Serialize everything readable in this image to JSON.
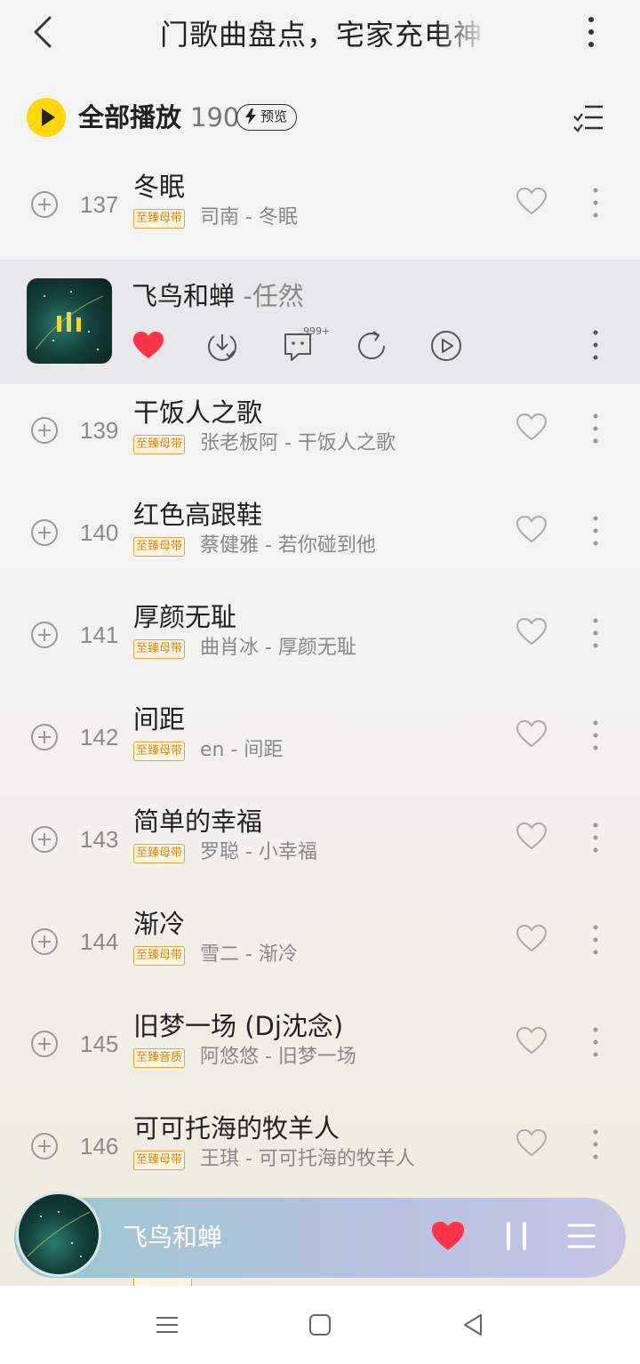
{
  "header": {
    "title": "门歌曲盘点，宅家充电神",
    "back_icon": "chevron-left-icon",
    "more_icon": "more-vertical-icon"
  },
  "playall": {
    "label": "全部播放",
    "count": "190",
    "preview_label": "预览",
    "accent": "#ffd60a"
  },
  "current_song": {
    "title": "飞鸟和蝉",
    "artist": " -任然",
    "comment_count": "999+",
    "liked": true
  },
  "songs": [
    {
      "num": "137",
      "title": "冬眠",
      "tag": "至臻母带",
      "artist": "司南 - 冬眠"
    },
    {
      "num": "139",
      "title": "干饭人之歌",
      "tag": "至臻母带",
      "artist": "张老板阿 - 干饭人之歌"
    },
    {
      "num": "140",
      "title": "红色高跟鞋",
      "tag": "至臻母带",
      "artist": "蔡健雅 - 若你碰到他"
    },
    {
      "num": "141",
      "title": "厚颜无耻",
      "tag": "至臻母带",
      "artist": "曲肖冰 - 厚颜无耻"
    },
    {
      "num": "142",
      "title": "间距",
      "tag": "至臻母带",
      "artist": "en - 间距"
    },
    {
      "num": "143",
      "title": "简单的幸福",
      "tag": "至臻母带",
      "artist": "罗聪 - 小幸福"
    },
    {
      "num": "144",
      "title": "渐冷",
      "tag": "至臻母带",
      "artist": "雪二 - 渐冷"
    },
    {
      "num": "145",
      "title": "旧梦一场 (Dj沈念)",
      "tag": "至臻音质",
      "artist": "阿悠悠 - 旧梦一场"
    },
    {
      "num": "146",
      "title": "可可托海的牧羊人",
      "tag": "至臻母带",
      "artist": "王琪 - 可可托海的牧羊人"
    }
  ],
  "player": {
    "title": "飞鸟和蝉",
    "liked": true,
    "heart_color": "#ff3347"
  },
  "navbar": {
    "menu_icon": "menu-icon",
    "home_icon": "square-home-icon",
    "back_icon": "triangle-back-icon"
  }
}
